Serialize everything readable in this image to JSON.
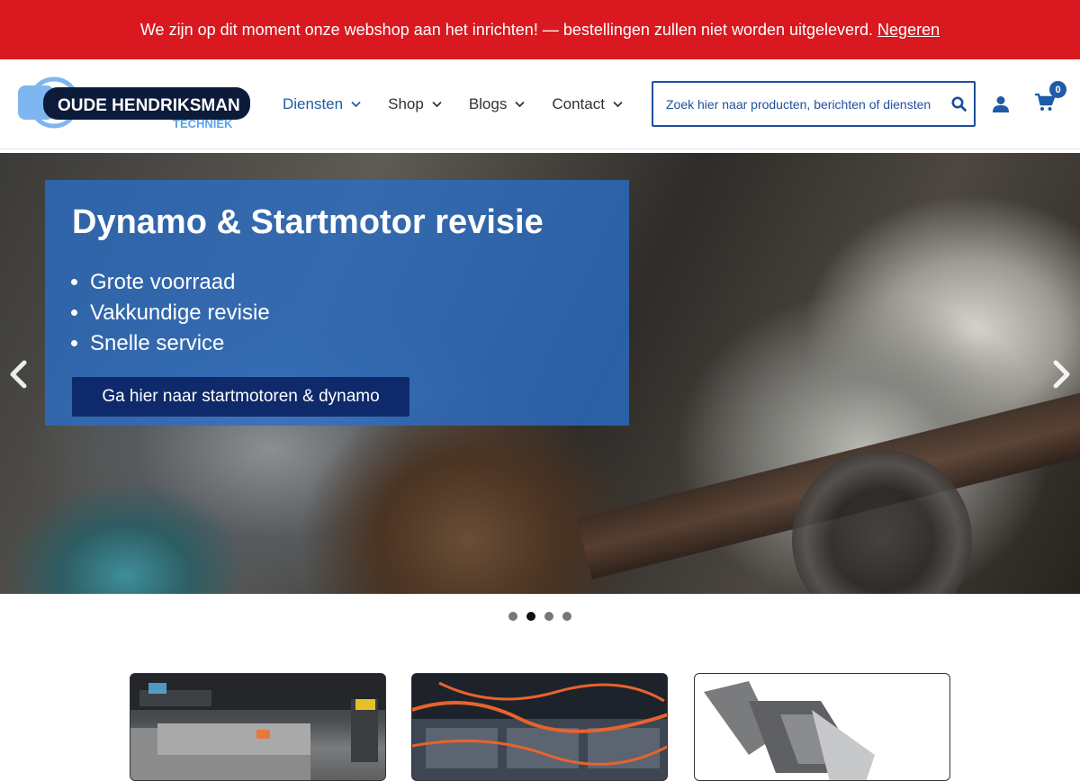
{
  "notice": {
    "text": "We zijn op dit moment onze webshop aan het inrichten! — bestellingen zullen niet worden uitgeleverd.",
    "dismiss_label": "Negeren"
  },
  "header": {
    "logo": {
      "title": "OUDE HENDRIKSMAN",
      "subtitle": "TECHNIEK"
    },
    "nav": [
      {
        "label": "Diensten"
      },
      {
        "label": "Shop"
      },
      {
        "label": "Blogs"
      },
      {
        "label": "Contact"
      }
    ],
    "search": {
      "placeholder": "Zoek hier naar producten, berichten of diensten"
    },
    "cart_count": "0"
  },
  "hero": {
    "title": "Dynamo & Startmotor revisie",
    "bullets": [
      "Grote voorraad",
      "Vakkundige revisie",
      "Snelle service"
    ],
    "cta_label": "Ga hier naar startmotoren & dynamo",
    "active_slide": 2,
    "slide_count": 4
  },
  "colors": {
    "notice_bg": "#d9191f",
    "brand_blue": "#1e5ba8",
    "cta_bg": "#0f2a6b"
  }
}
